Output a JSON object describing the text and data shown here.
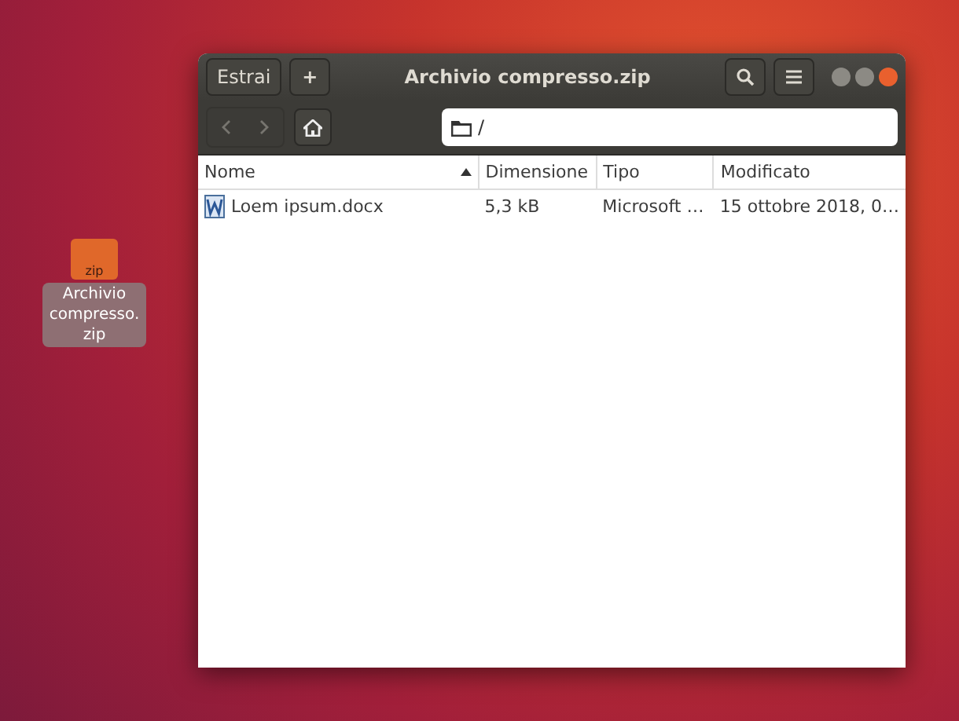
{
  "desktop_icon": {
    "badge": "zip",
    "label": "Archivio compresso.zip",
    "selected": true
  },
  "window": {
    "title": "Archivio compresso.zip",
    "buttons": [
      {
        "label": "Estrai",
        "kind": "text"
      },
      {
        "label": "+",
        "kind": "text"
      }
    ],
    "path": "/",
    "table": {
      "columns": [
        {
          "label": "Nome",
          "sorted": true
        },
        {
          "label": "Dimensione",
          "sorted": false
        },
        {
          "label": "Tipo",
          "sorted": false
        },
        {
          "label": "Modificato",
          "sorted": false
        }
      ],
      "rows": [
        {
          "cells": [
            "Loem ipsum.docx",
            "5,3 kB",
            "Microsoft …",
            "15 ottobre 2018, 0…"
          ]
        }
      ]
    }
  }
}
